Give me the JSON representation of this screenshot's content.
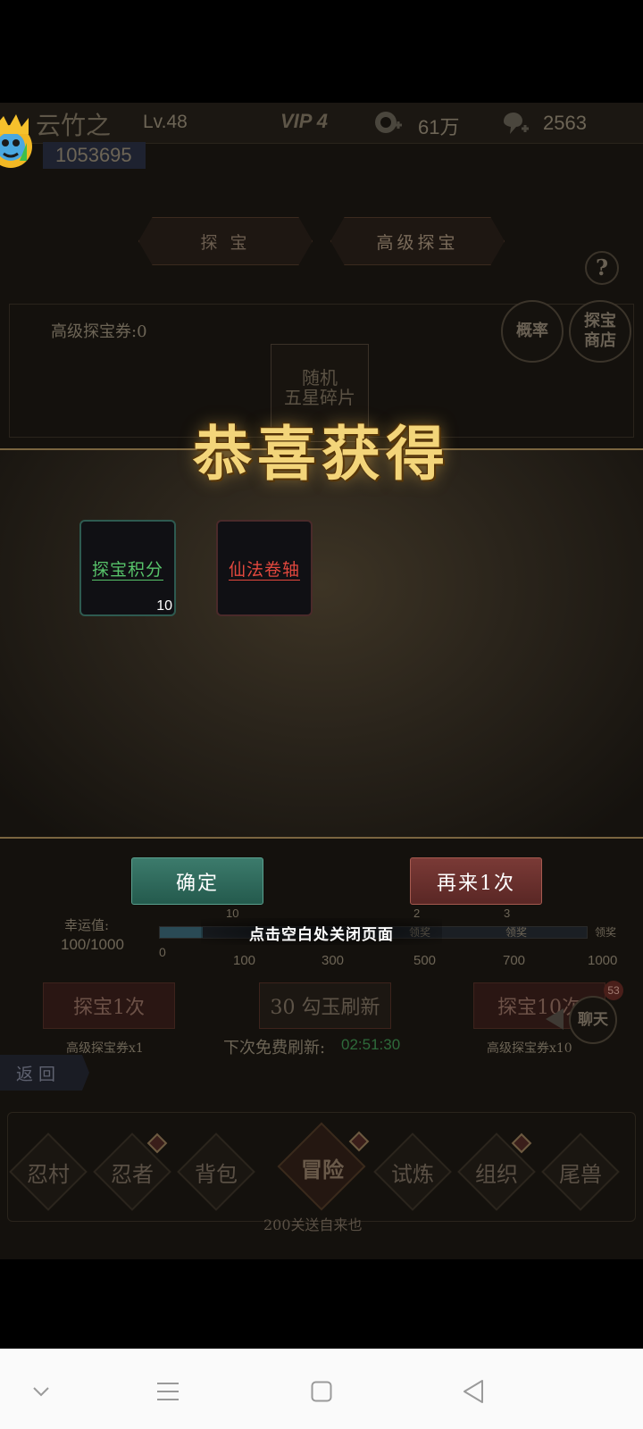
{
  "player": {
    "name": "云竹之",
    "level": "Lv.48",
    "vip": "VIP 4",
    "power": "1053695"
  },
  "currency": {
    "coins": "61万",
    "gems": "2563"
  },
  "tabs": [
    {
      "label": "探 宝"
    },
    {
      "label": "高级探宝"
    }
  ],
  "side_buttons": {
    "probability": "概率",
    "shop_line1": "探宝",
    "shop_line2": "商店"
  },
  "ticket_count_label": "高级探宝券:0",
  "prize_display": {
    "line1": "随机",
    "line2": "五星碎片"
  },
  "popup": {
    "title": "恭喜获得",
    "rewards": [
      {
        "name": "探宝积分",
        "count": "10",
        "color": "#57c36a"
      },
      {
        "name": "仙法卷轴",
        "count": "",
        "color": "#e2483e"
      }
    ],
    "confirm_label": "确定",
    "again_label": "再来1次",
    "close_hint": "点击空白处关闭页面"
  },
  "luck": {
    "label": "幸运值:",
    "value": "100/1000",
    "start": "0",
    "milestones": [
      {
        "top": "10",
        "value": "100",
        "badge": ""
      },
      {
        "top": "",
        "value": "300",
        "badge": ""
      },
      {
        "top": "2",
        "value": "500",
        "badge": "领奖"
      },
      {
        "top": "3",
        "value": "700",
        "badge": "领奖"
      },
      {
        "top": "",
        "value": "1000",
        "badge": "领奖"
      }
    ]
  },
  "draw": {
    "once_label": "探宝1次",
    "refresh_label": "30 勾玉刷新",
    "ten_label": "探宝10次",
    "once_cost": "高级探宝券x1",
    "ten_cost": "高级探宝券x10",
    "free_refresh_label": "下次免费刷新:",
    "free_refresh_time": "02:51:30"
  },
  "chat": {
    "label": "聊天",
    "badge": "53"
  },
  "back_label": "返 回",
  "bottom_nav": [
    {
      "label": "忍村",
      "dot": false
    },
    {
      "label": "忍者",
      "dot": true
    },
    {
      "label": "背包",
      "dot": false
    },
    {
      "label": "冒险",
      "dot": true
    },
    {
      "label": "试炼",
      "dot": false
    },
    {
      "label": "组织",
      "dot": true
    },
    {
      "label": "尾兽",
      "dot": false
    }
  ],
  "adventure_sub": "200关送自来也"
}
